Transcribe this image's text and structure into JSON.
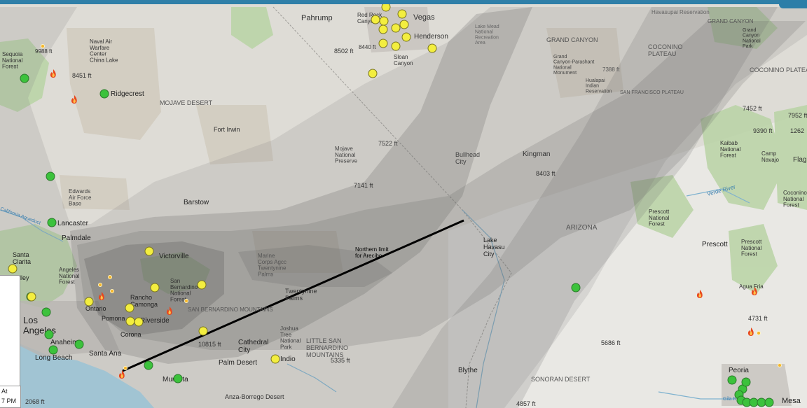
{
  "places": [
    {
      "id": "pahrump",
      "text": "Pahrump"
    },
    {
      "id": "red-rock-canyon",
      "text": "Red Rock Canyon"
    },
    {
      "id": "las-vegas",
      "text": "Vegas"
    },
    {
      "id": "henderson",
      "text": "Henderson"
    },
    {
      "id": "sloan-canyon",
      "text": "Sloan Canyon"
    },
    {
      "id": "elev-8502",
      "text": "8502 ft"
    },
    {
      "id": "elev-8440",
      "text": "8440 ft"
    },
    {
      "id": "lake-mead",
      "text": "Lake Mead National Recreation Area"
    },
    {
      "id": "hualapai-reservation",
      "text": "Havasupai Reservation"
    },
    {
      "id": "grand-canyon",
      "text": "GRAND CANYON"
    },
    {
      "id": "grand-canyon-np",
      "text": "Grand Canyon National Park"
    },
    {
      "id": "coconino-plateau",
      "text": "COCONINO PLATEAU"
    },
    {
      "id": "coconino-plateau-2",
      "text": "COCONINO PLATEAU"
    },
    {
      "id": "grand-canyon-2",
      "text": "GRAND CANYON"
    },
    {
      "id": "grand-canyon-parashant",
      "text": "Grand Canyon-Parashant National Monument"
    },
    {
      "id": "elev-7388",
      "text": "7388 ft"
    },
    {
      "id": "hualapai-indian",
      "text": "Hualapai Indian Reservation"
    },
    {
      "id": "san-francisco-plateau",
      "text": "SAN FRANCISCO PLATEAU"
    },
    {
      "id": "elev-7452",
      "text": "7452 ft"
    },
    {
      "id": "elev-7952",
      "text": "7952 ft"
    },
    {
      "id": "elev-9390",
      "text": "9390 ft"
    },
    {
      "id": "elev-1262",
      "text": "1262"
    },
    {
      "id": "sequoia-nf",
      "text": "Sequoia National Forest"
    },
    {
      "id": "elev-9988",
      "text": "9988 ft"
    },
    {
      "id": "naval-air",
      "text": "Naval Air Warfare Center China Lake"
    },
    {
      "id": "elev-8451",
      "text": "8451 ft"
    },
    {
      "id": "ridgecrest",
      "text": "Ridgecrest"
    },
    {
      "id": "mojave-desert",
      "text": "MOJAVE DESERT"
    },
    {
      "id": "fort-irwin",
      "text": "Fort Irwin"
    },
    {
      "id": "elev-7522",
      "text": "7522 ft"
    },
    {
      "id": "mojave-np",
      "text": "Mojave National Preserve"
    },
    {
      "id": "bullhead-city",
      "text": "Bullhead City"
    },
    {
      "id": "kingman",
      "text": "Kingman"
    },
    {
      "id": "elev-8403",
      "text": "8403 ft"
    },
    {
      "id": "kaibab-nf",
      "text": "Kaibab National Forest"
    },
    {
      "id": "camp-navajo",
      "text": "Camp Navajo"
    },
    {
      "id": "flagstaff",
      "text": "Flag"
    },
    {
      "id": "coconino-nf",
      "text": "Coconino National Forest"
    },
    {
      "id": "edwards-afb",
      "text": "Edwards Air Force Base"
    },
    {
      "id": "elev-7141",
      "text": "7141 ft"
    },
    {
      "id": "barstow",
      "text": "Barstow"
    },
    {
      "id": "verde-river",
      "text": "Verde River"
    },
    {
      "id": "prescott-nf",
      "text": "Prescott National Forest"
    },
    {
      "id": "lancaster",
      "text": "Lancaster"
    },
    {
      "id": "palmdale",
      "text": "Palmdale"
    },
    {
      "id": "california-aqueduct",
      "text": "California Aqueduct"
    },
    {
      "id": "arizona",
      "text": "ARIZONA"
    },
    {
      "id": "lake-havasu",
      "text": "Lake Havasu City"
    },
    {
      "id": "prescott",
      "text": "Prescott"
    },
    {
      "id": "prescott-nf-2",
      "text": "Prescott National Forest"
    },
    {
      "id": "santa-clarita",
      "text": "Santa Clarita"
    },
    {
      "id": "victorville",
      "text": "Victorville"
    },
    {
      "id": "marine-corps",
      "text": "Marine Corps Agcc Twentynine Palms"
    },
    {
      "id": "angeles-nf",
      "text": "Angeles National Forest"
    },
    {
      "id": "valley",
      "text": "lley"
    },
    {
      "id": "san-bernardino-nf",
      "text": "San Bernardino National Forest"
    },
    {
      "id": "agua-fria",
      "text": "Agua Fria"
    },
    {
      "id": "rancho",
      "text": "Rancho Camonga"
    },
    {
      "id": "ontario",
      "text": "Ontario"
    },
    {
      "id": "twentynine-palms",
      "text": "Twentynine Palms"
    },
    {
      "id": "san-bernardino-mtns",
      "text": "SAN BERNARDINO MOUNTAINS"
    },
    {
      "id": "pomona",
      "text": "Pomona"
    },
    {
      "id": "riverside",
      "text": "Riverside"
    },
    {
      "id": "los-angeles",
      "text": "Los Angeles"
    },
    {
      "id": "elev-4731",
      "text": "4731 ft"
    },
    {
      "id": "corona",
      "text": "Corona"
    },
    {
      "id": "indio",
      "text": "Indio"
    },
    {
      "id": "joshua-tree",
      "text": "Joshua Tree National Park"
    },
    {
      "id": "anaheim",
      "text": "Anaheim"
    },
    {
      "id": "cathedral-city",
      "text": "Cathedral City"
    },
    {
      "id": "little-sbm",
      "text": "LITTLE SAN BERNARDINO MOUNTAINS"
    },
    {
      "id": "elev-10815",
      "text": "10815 ft"
    },
    {
      "id": "elev-5686",
      "text": "5686 ft"
    },
    {
      "id": "long-beach",
      "text": "Long Beach"
    },
    {
      "id": "santa-ana",
      "text": "Santa Ana"
    },
    {
      "id": "palm-desert",
      "text": "Palm Desert"
    },
    {
      "id": "elev-5335",
      "text": "5335 ft"
    },
    {
      "id": "blythe",
      "text": "Blythe"
    },
    {
      "id": "sonoran-desert",
      "text": "SONORAN DESERT"
    },
    {
      "id": "peoria",
      "text": "Peoria"
    },
    {
      "id": "murrieta",
      "text": "Murrieta"
    },
    {
      "id": "anza-borrego",
      "text": "Anza-Borrego Desert"
    },
    {
      "id": "gila-river",
      "text": "Gila River"
    },
    {
      "id": "mesa",
      "text": "Mesa"
    },
    {
      "id": "elev-2068",
      "text": "2068 ft"
    },
    {
      "id": "elev-4857",
      "text": "4857 ft"
    }
  ],
  "annotation": {
    "line1": "Northern limit",
    "line2": "for Arecibo"
  },
  "side_clock": {
    "line1": "At",
    "line2": "7 PM"
  },
  "colors": {
    "green_marker": "#3cc23c",
    "yellow_marker": "#f3ee3f",
    "fire_icon": "#e8481e",
    "smoke": "#5a5a5a",
    "limit_line": "#000000"
  }
}
